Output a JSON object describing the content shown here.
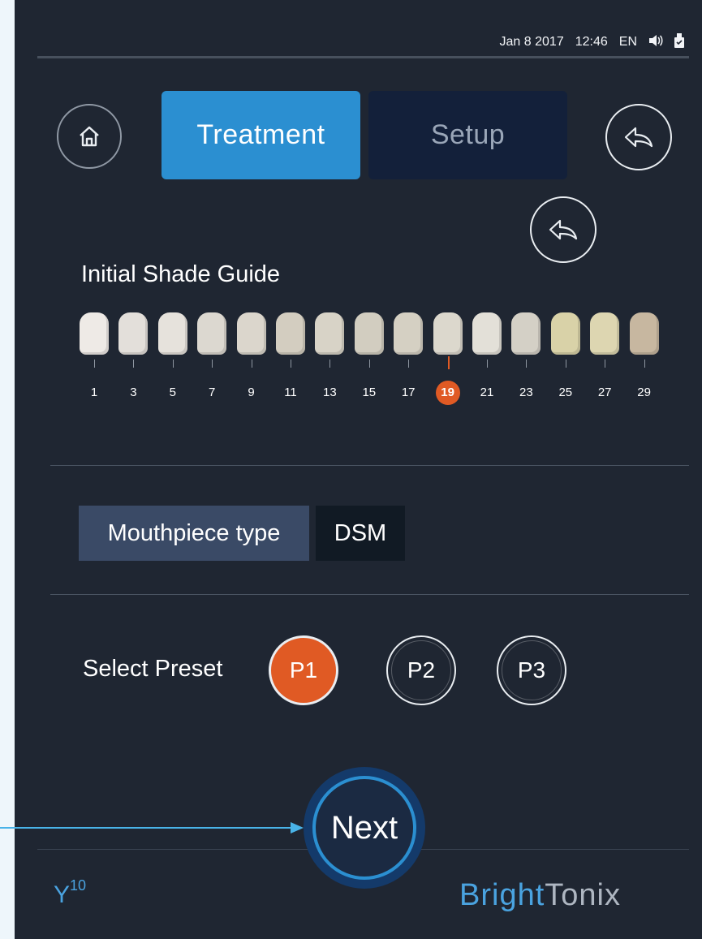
{
  "status": {
    "date": "Jan 8 2017",
    "time": "12:46",
    "language": "EN",
    "icons": [
      "speaker-icon",
      "usb-drive-icon"
    ]
  },
  "nav": {
    "tabs": [
      {
        "label": "Treatment",
        "active": true
      },
      {
        "label": "Setup",
        "active": false
      }
    ],
    "icons": [
      "home-icon",
      "back-arrow-icon"
    ]
  },
  "shade_guide": {
    "title": "Initial Shade Guide",
    "numbers": [
      "1",
      "3",
      "5",
      "7",
      "9",
      "11",
      "13",
      "15",
      "17",
      "19",
      "21",
      "23",
      "25",
      "27",
      "29"
    ],
    "selected": "19",
    "colors": [
      "#eeeae6",
      "#e3dfda",
      "#e6e2dc",
      "#dcd8d0",
      "#dbd6cc",
      "#d3cdc0",
      "#d8d3c7",
      "#d2cdc0",
      "#d5d0c3",
      "#dcd8cd",
      "#e3e0d8",
      "#d4d0c6",
      "#d9d2a8",
      "#ddd6b1",
      "#c7b7a0"
    ]
  },
  "mouthpiece": {
    "label": "Mouthpiece type",
    "value": "DSM"
  },
  "preset": {
    "label": "Select Preset",
    "options": [
      {
        "label": "P1",
        "active": true
      },
      {
        "label": "P2",
        "active": false
      },
      {
        "label": "P3",
        "active": false
      }
    ]
  },
  "next": {
    "label": "Next"
  },
  "footer": {
    "model": "Y",
    "model_sup": "10",
    "brand_a": "Bright",
    "brand_b": "Tonix"
  },
  "theme": {
    "accent": "#2b8fd1",
    "highlight": "#e05a24",
    "background": "#1f2632"
  }
}
